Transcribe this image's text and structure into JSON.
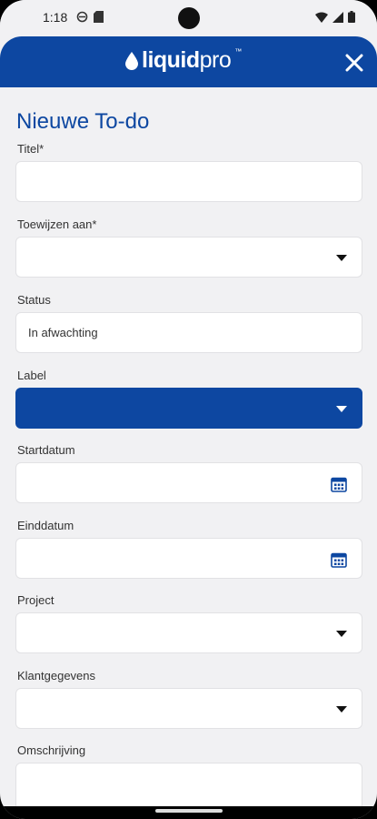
{
  "status_bar": {
    "time": "1:18",
    "icons_left": [
      "data-saver-icon",
      "sim-icon"
    ],
    "icons_right": [
      "wifi-icon",
      "signal-icon",
      "battery-icon"
    ]
  },
  "header": {
    "logo_text_bold": "liquid",
    "logo_text_light": "pro",
    "logo_tm": "™",
    "close_icon": "close-icon",
    "background": "#0d47a1"
  },
  "form": {
    "title": "Nieuwe To-do",
    "fields": {
      "titel": {
        "label": "Titel*",
        "value": ""
      },
      "toewijzen": {
        "label": "Toewijzen aan*",
        "value": ""
      },
      "status": {
        "label": "Status",
        "value": "In afwachting"
      },
      "label": {
        "label": "Label",
        "value": ""
      },
      "startdatum": {
        "label": "Startdatum",
        "value": ""
      },
      "einddatum": {
        "label": "Einddatum",
        "value": ""
      },
      "project": {
        "label": "Project",
        "value": ""
      },
      "klantgegevens": {
        "label": "Klantgegevens",
        "value": ""
      },
      "omschrijving": {
        "label": "Omschrijving",
        "value": ""
      }
    }
  },
  "colors": {
    "accent": "#0d47a1",
    "background": "#f1f1f3",
    "field": "#ffffff"
  }
}
